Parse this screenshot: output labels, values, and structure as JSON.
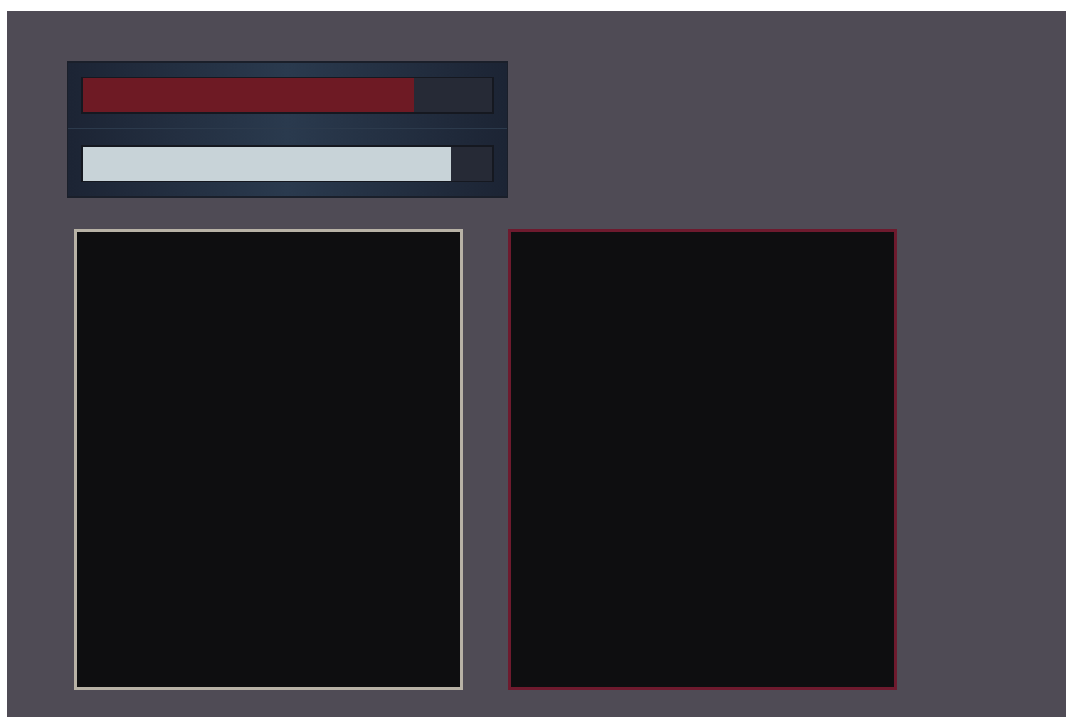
{
  "meters": [
    {
      "level": 0.81,
      "color": "#6e1a24"
    },
    {
      "level": 0.9,
      "color": "#c8d3d8"
    }
  ],
  "panels": [
    {
      "color": "#b8b2a6"
    },
    {
      "color": "#6e1a2e"
    }
  ]
}
